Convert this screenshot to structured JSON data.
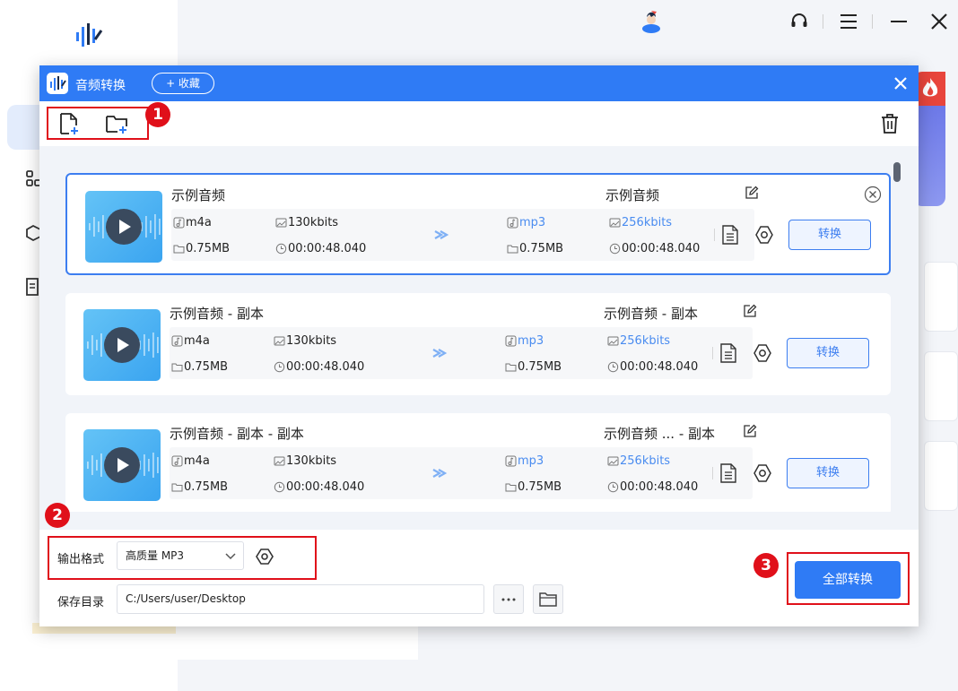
{
  "background_app": {
    "icons": [
      "app-logo-icon",
      "user-avatar-icon",
      "headset-icon",
      "menu-icon",
      "minimize-icon",
      "close-icon"
    ]
  },
  "dialog": {
    "title": "音频转换",
    "favorite_label": "+ 收藏",
    "toolbar": {
      "icons": [
        "add-file-icon",
        "add-folder-icon",
        "trash-icon"
      ]
    },
    "files": [
      {
        "source_name": "示例音频",
        "target_name": "示例音频",
        "source_format": "m4a",
        "source_bitrate": "130kbits",
        "source_size": "0.75MB",
        "source_duration": "00:00:48.040",
        "target_format": "mp3",
        "target_bitrate": "256kbits",
        "target_size": "0.75MB",
        "target_duration": "00:00:48.040",
        "convert_label": "转换",
        "selected": true
      },
      {
        "source_name": "示例音频 - 副本",
        "target_name": "示例音频 - 副本",
        "source_format": "m4a",
        "source_bitrate": "130kbits",
        "source_size": "0.75MB",
        "source_duration": "00:00:48.040",
        "target_format": "mp3",
        "target_bitrate": "256kbits",
        "target_size": "0.75MB",
        "target_duration": "00:00:48.040",
        "convert_label": "转换",
        "selected": false
      },
      {
        "source_name": "示例音频 - 副本 - 副本",
        "target_name": "示例音频 ... - 副本",
        "source_format": "m4a",
        "source_bitrate": "130kbits",
        "source_size": "0.75MB",
        "source_duration": "00:00:48.040",
        "target_format": "mp3",
        "target_bitrate": "256kbits",
        "target_size": "0.75MB",
        "target_duration": "00:00:48.040",
        "convert_label": "转换",
        "selected": false
      }
    ],
    "output": {
      "format_label": "输出格式",
      "format_value": "高质量 MP3",
      "save_dir_label": "保存目录",
      "save_dir_value": "C:/Users/user/Desktop",
      "more_label": "···",
      "convert_all_label": "全部转换"
    }
  },
  "annotations": [
    {
      "number": "1"
    },
    {
      "number": "2"
    },
    {
      "number": "3"
    }
  ],
  "colors": {
    "accent": "#2f7bf5",
    "annotation": "#e0101a",
    "target_text": "#4a8cf0"
  }
}
